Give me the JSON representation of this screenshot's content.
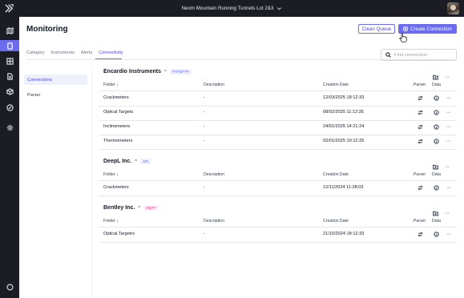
{
  "topbar": {
    "project_name": "Neom Mountain Running Tunnels Lot 2&3",
    "project_icon": "chevron-down-icon",
    "avatar": "user-avatar"
  },
  "rail": {
    "items": [
      "map-icon",
      "monitoring-icon",
      "dashboard-icon",
      "document-icon",
      "package-icon",
      "link-icon",
      "settings-icon",
      "chat-icon"
    ],
    "active_index": 1
  },
  "header": {
    "title": "Monitoring",
    "clean_label": "Clean Queue",
    "create_label": "Create Connection"
  },
  "tabs": [
    {
      "label": "Category"
    },
    {
      "label": "Instruments"
    },
    {
      "label": "Alerts"
    },
    {
      "label": "Connectivity",
      "active": true
    }
  ],
  "search": {
    "placeholder": "Find connection"
  },
  "subnav": [
    {
      "label": "Connections",
      "active": true
    },
    {
      "label": "Parser"
    }
  ],
  "columns": {
    "folder": "Folder",
    "sort_icon": "arrow-down-icon",
    "description": "Description",
    "creation_date": "Creation Date",
    "parser": "Parser",
    "data": "Data"
  },
  "groups": [
    {
      "name": "Encardio Instruments",
      "badge": "FTP/SFTP",
      "rows": [
        {
          "folder": "Crackmeters",
          "description": "-",
          "date": "12/03/2025 18:12:33"
        },
        {
          "folder": "Optical Targets",
          "description": "-",
          "date": "08/02/2025 11:12:35"
        },
        {
          "folder": "Inclinometers",
          "description": "-",
          "date": "24/01/2025 14:21:24"
        },
        {
          "folder": "Thermometers",
          "description": "-",
          "date": "02/01/2025 10:12:25"
        }
      ]
    },
    {
      "name": "DeepL Inc.",
      "badge": "API",
      "rows": [
        {
          "folder": "Crackmeters",
          "description": "-",
          "date": "12/11/2024 11:28:03"
        }
      ]
    },
    {
      "name": "Bentley Inc.",
      "badge": "MQTT",
      "rows": [
        {
          "folder": "Optical Targetrs",
          "description": "-",
          "date": "21/10/2024 18:12:33"
        }
      ]
    }
  ],
  "colors": {
    "accent": "#6b6cf0",
    "rail": "#1c1d24",
    "badge_mqtt": "#db2777"
  }
}
